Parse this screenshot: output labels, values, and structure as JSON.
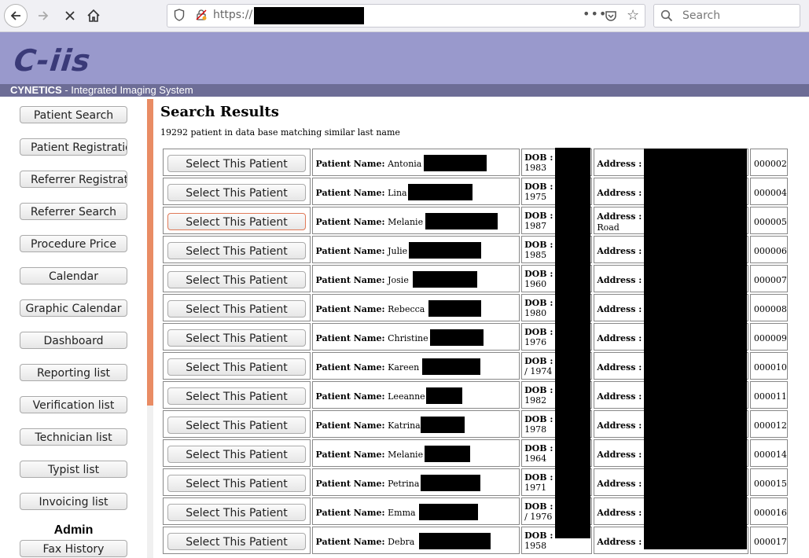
{
  "browser": {
    "url_prefix": "https://",
    "search_placeholder": "Search",
    "url_menu": "•••"
  },
  "site": {
    "logo": "C-iis",
    "brand": "CYNETICS",
    "tagline": " - Integrated Imaging System"
  },
  "sidebar": {
    "items": [
      "Patient Search",
      "Patient Registration",
      "Referrer Registration",
      "Referrer Search",
      "Procedure Price",
      "Calendar",
      "Graphic Calendar",
      "Dashboard",
      "Reporting list",
      "Verification list",
      "Technician list",
      "Typist list",
      "Invoicing list"
    ],
    "admin_label": "Admin",
    "admin_items": [
      "Fax History"
    ]
  },
  "results": {
    "title": "Search Results",
    "count_text": "19292 patient in data base matching similar last name",
    "select_label": "Select This Patient",
    "name_label": "Patient Name:",
    "dob_label": "DOB :",
    "address_label": "Address :",
    "rows": [
      {
        "first": "Antonia",
        "dob": "1983",
        "address": "",
        "id": "000002"
      },
      {
        "first": "Lina",
        "dob": "1975",
        "address": "",
        "id": "000004"
      },
      {
        "first": "Melanie",
        "dob": "1987",
        "address": "Road",
        "id": "000005"
      },
      {
        "first": "Julie",
        "dob": "1985",
        "address": "",
        "id": "000006"
      },
      {
        "first": "Josie",
        "dob": "1960",
        "address": "",
        "id": "000007"
      },
      {
        "first": "Rebecca",
        "dob": "1980",
        "address": "",
        "id": "000008"
      },
      {
        "first": "Christine",
        "dob": "1976",
        "address": "",
        "id": "000009"
      },
      {
        "first": "Kareen",
        "dob": "/ 1974",
        "address": "",
        "id": "000010"
      },
      {
        "first": "Leeanne",
        "dob": "1982",
        "address": "",
        "id": "000011"
      },
      {
        "first": "Katrina",
        "dob": "1978",
        "address": "",
        "id": "000012"
      },
      {
        "first": "Melanie",
        "dob": "1964",
        "address": "",
        "id": "000014"
      },
      {
        "first": "Petrina",
        "dob": "1971",
        "address": "",
        "id": "000015"
      },
      {
        "first": "Emma",
        "dob": "/ 1976",
        "address": "",
        "id": "000016"
      },
      {
        "first": "Debra",
        "dob": "1958",
        "address": "",
        "id": "000017"
      }
    ]
  }
}
